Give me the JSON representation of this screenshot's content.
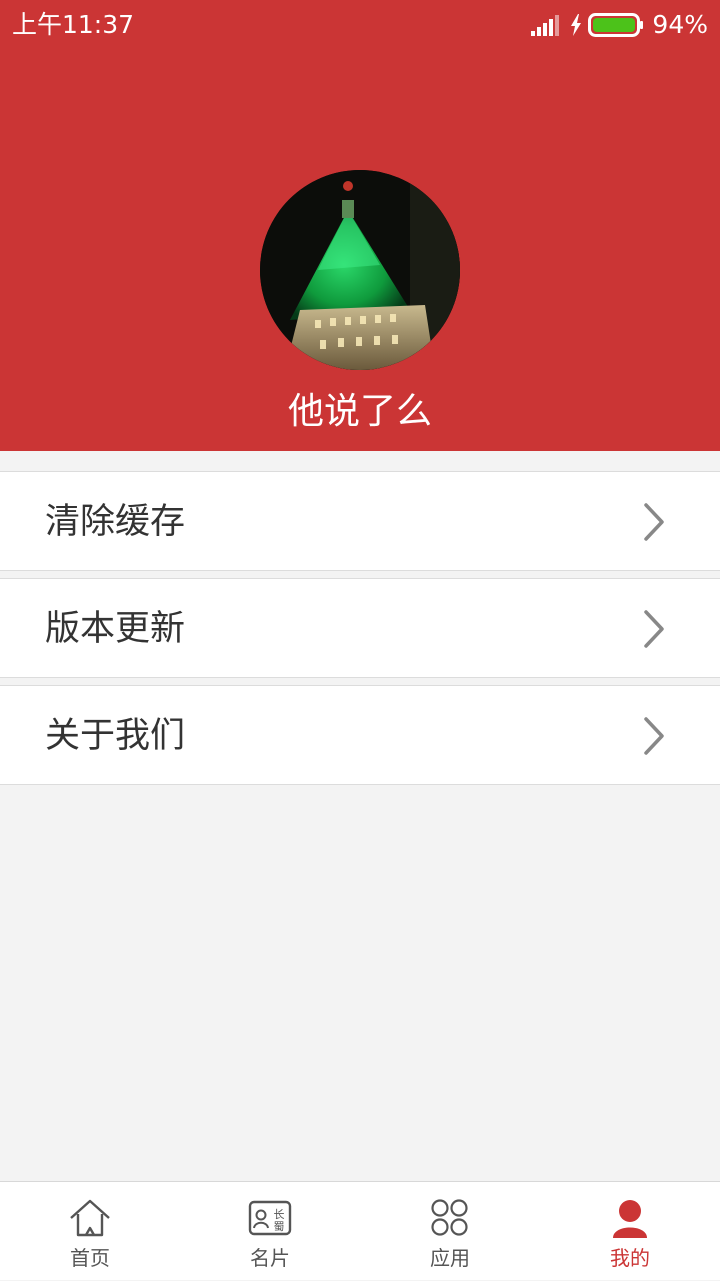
{
  "status_bar": {
    "time": "上午11:37",
    "battery": "94%"
  },
  "profile": {
    "username": "他说了么"
  },
  "menu": [
    {
      "label": "清除缓存"
    },
    {
      "label": "版本更新"
    },
    {
      "label": "关于我们"
    }
  ],
  "tabs": [
    {
      "label": "首页",
      "icon": "home-icon"
    },
    {
      "label": "名片",
      "icon": "business-card-icon",
      "badge_text": "长蜀"
    },
    {
      "label": "应用",
      "icon": "apps-icon"
    },
    {
      "label": "我的",
      "icon": "person-icon",
      "active": true
    }
  ],
  "colors": {
    "header": "#cb3535",
    "active_tab": "#cb3535",
    "background": "#f3f3f3"
  }
}
